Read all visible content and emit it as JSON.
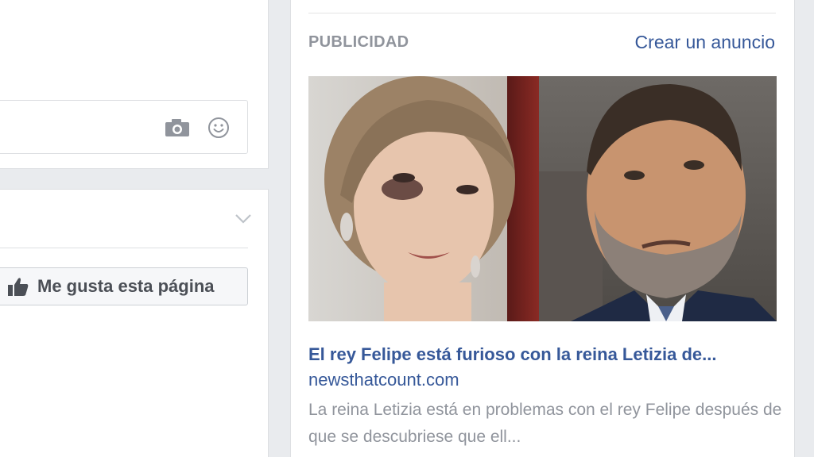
{
  "composer": {
    "camera_icon": "camera-icon",
    "emoji_icon": "smiley-icon"
  },
  "page_card": {
    "dropdown_icon": "chevron-down-icon",
    "like_button_label": "Me gusta esta página",
    "like_icon": "thumbs-up-icon"
  },
  "ad": {
    "section_label": "PUBLICIDAD",
    "create_ad_link": "Crear un anuncio",
    "title": "El rey Felipe está furioso con la reina Letizia de...",
    "domain": "newsthatcount.com",
    "description": "La reina Letizia está en problemas con el rey Felipe después de que se descubriese que ell..."
  },
  "colors": {
    "link": "#365899",
    "muted": "#90949c",
    "background": "#e9ebee"
  }
}
